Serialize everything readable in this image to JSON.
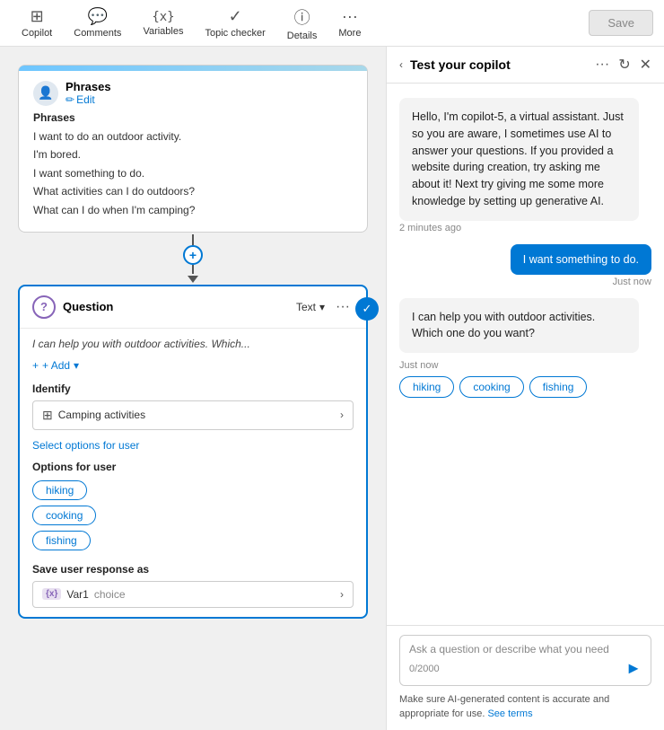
{
  "toolbar": {
    "items": [
      {
        "id": "copilot",
        "label": "Copilot",
        "icon": "⊞"
      },
      {
        "id": "comments",
        "label": "Comments",
        "icon": "💬"
      },
      {
        "id": "variables",
        "label": "Variables",
        "icon": "{x}"
      },
      {
        "id": "topic-checker",
        "label": "Topic checker",
        "icon": "✓"
      },
      {
        "id": "details",
        "label": "Details",
        "icon": "ℹ"
      },
      {
        "id": "more",
        "label": "More",
        "icon": "···"
      }
    ],
    "save_label": "Save"
  },
  "phrases_card": {
    "title": "Phrases",
    "edit_label": "Edit",
    "section_label": "Phrases",
    "lines": [
      "I want to do an outdoor activity.",
      "I'm bored.",
      "I want something to do.",
      "What activities can I do outdoors?",
      "What can I do when I'm camping?"
    ]
  },
  "question_card": {
    "title": "Question",
    "type_label": "Text",
    "preview": "I can help you with outdoor activities. Which...",
    "add_label": "+ Add",
    "identify_label": "Identify",
    "identify_value": "Camping activities",
    "select_options_label": "Select options for user",
    "options_label": "Options for user",
    "options": [
      "hiking",
      "cooking",
      "fishing"
    ],
    "save_response_label": "Save user response as",
    "var_icon": "{x}",
    "var_name": "Var1",
    "var_type": "choice"
  },
  "copilot_panel": {
    "title": "Test your copilot",
    "bot_message_1": "Hello, I'm copilot-5, a virtual assistant. Just so you are aware, I sometimes use AI to answer your questions. If you provided a website during creation, try asking me about it! Next try giving me some more knowledge by setting up generative AI.",
    "time_1": "2 minutes ago",
    "user_message": "I want something to do.",
    "time_user": "Just now",
    "bot_message_2": "I can help you with outdoor activities. Which one do you want?",
    "time_2": "Just now",
    "choice_tags": [
      "hiking",
      "cooking",
      "fishing"
    ],
    "input_placeholder": "Ask a question or describe what you need",
    "char_count": "0/2000",
    "footer_note": "Make sure AI-generated content is accurate and appropriate for use.",
    "footer_link_label": "See terms"
  }
}
